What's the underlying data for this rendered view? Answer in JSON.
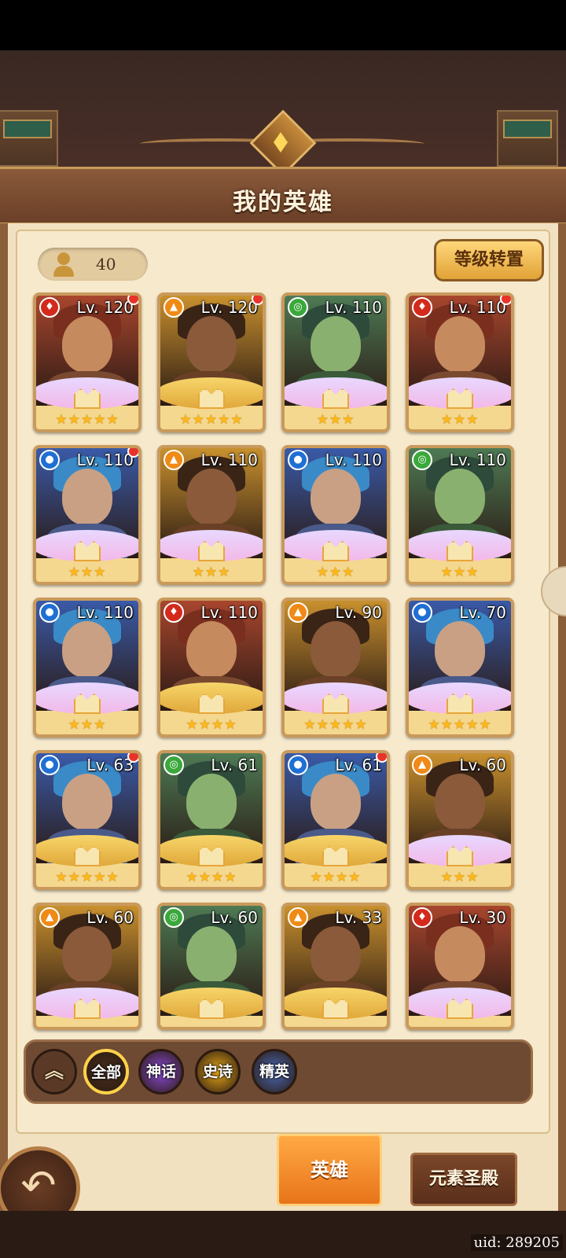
{
  "header": {
    "title": "我的英雄"
  },
  "hero_count": "40",
  "level_transfer_label": "等级转置",
  "heroes": [
    {
      "level": "Lv. 120",
      "element": "fire",
      "stars": "★★★★★",
      "dot": true,
      "frame": "pink"
    },
    {
      "level": "Lv. 120",
      "element": "light",
      "stars": "★★★★★",
      "dot": true,
      "frame": "gold"
    },
    {
      "level": "Lv. 110",
      "element": "wind",
      "stars": "★★★",
      "dot": false,
      "frame": "pink"
    },
    {
      "level": "Lv. 110",
      "element": "fire",
      "stars": "★★★",
      "dot": true,
      "frame": "pink"
    },
    {
      "level": "Lv. 110",
      "element": "water",
      "stars": "★★★",
      "dot": true,
      "frame": "pink"
    },
    {
      "level": "Lv. 110",
      "element": "light",
      "stars": "★★★",
      "dot": false,
      "frame": "pink"
    },
    {
      "level": "Lv. 110",
      "element": "water",
      "stars": "★★★",
      "dot": false,
      "frame": "pink"
    },
    {
      "level": "Lv. 110",
      "element": "wind",
      "stars": "★★★",
      "dot": false,
      "frame": "pink"
    },
    {
      "level": "Lv. 110",
      "element": "water",
      "stars": "★★★",
      "dot": false,
      "frame": "pink"
    },
    {
      "level": "Lv. 110",
      "element": "fire",
      "stars": "★★★★",
      "dot": false,
      "frame": "gold"
    },
    {
      "level": "Lv. 90",
      "element": "light",
      "stars": "★★★★★",
      "dot": false,
      "frame": "pink"
    },
    {
      "level": "Lv. 70",
      "element": "water",
      "stars": "★★★★★",
      "dot": false,
      "frame": "pink"
    },
    {
      "level": "Lv. 63",
      "element": "water",
      "stars": "★★★★★",
      "dot": true,
      "frame": "gold"
    },
    {
      "level": "Lv. 61",
      "element": "wind",
      "stars": "★★★★",
      "dot": false,
      "frame": "gold"
    },
    {
      "level": "Lv. 61",
      "element": "water",
      "stars": "★★★★",
      "dot": true,
      "frame": "gold"
    },
    {
      "level": "Lv. 60",
      "element": "light",
      "stars": "★★★",
      "dot": false,
      "frame": "pink"
    },
    {
      "level": "Lv. 60",
      "element": "light",
      "stars": "",
      "dot": false,
      "frame": "pink"
    },
    {
      "level": "Lv. 60",
      "element": "wind",
      "stars": "",
      "dot": false,
      "frame": "gold"
    },
    {
      "level": "Lv. 33",
      "element": "light",
      "stars": "",
      "dot": false,
      "frame": "gold"
    },
    {
      "level": "Lv. 30",
      "element": "fire",
      "stars": "",
      "dot": false,
      "frame": "pink"
    }
  ],
  "element_colors": {
    "fire": "#d42a1c",
    "light": "#f08a16",
    "wind": "#3aa83a",
    "water": "#1f6fd4"
  },
  "filters": [
    {
      "label": "全部",
      "selected": true
    },
    {
      "label": "神话",
      "selected": false
    },
    {
      "label": "史诗",
      "selected": false
    },
    {
      "label": "精英",
      "selected": false
    }
  ],
  "tabs": {
    "heroes": "英雄",
    "temple": "元素圣殿"
  },
  "uid": "uid: 289205"
}
